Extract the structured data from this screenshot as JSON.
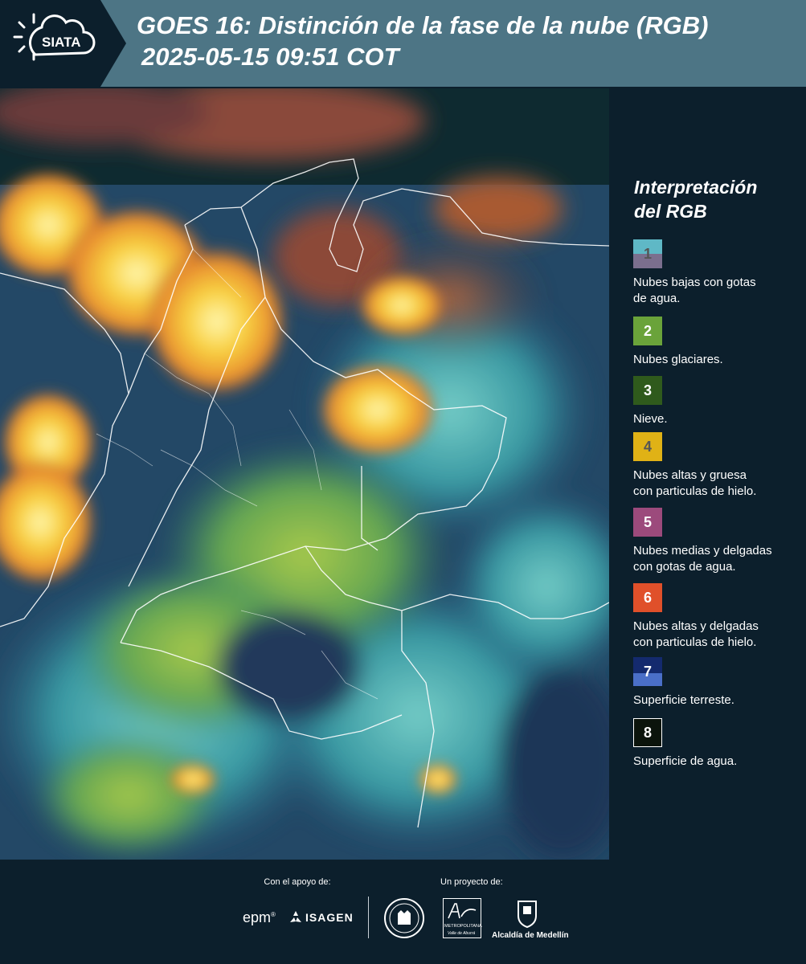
{
  "header": {
    "logo_text": "SIATA",
    "title": "GOES 16: Distinción de la fase de la nube (RGB)",
    "subtitle": "2025-05-15 09:51 COT",
    "logo_icon": "sun-cloud-icon"
  },
  "legend": {
    "title_line1": "Interpretación",
    "title_line2": "del RGB",
    "items": [
      {
        "number": "1",
        "color_top": "#5fb8c6",
        "color_bottom": "#7b6f8e",
        "number_color": "#555555",
        "text_line1": "Nubes bajas con gotas",
        "text_line2": "de agua."
      },
      {
        "number": "2",
        "color_top": "#6aa33a",
        "color_bottom": "#6aa33a",
        "number_color": "#ffffff",
        "text_line1": "Nubes glaciares.",
        "text_line2": ""
      },
      {
        "number": "3",
        "color_top": "#2f5a1c",
        "color_bottom": "#2f5a1c",
        "number_color": "#ffffff",
        "text_line1": "Nieve.",
        "text_line2": ""
      },
      {
        "number": "4",
        "color_top": "#e0b216",
        "color_bottom": "#e0b216",
        "number_color": "#555555",
        "text_line1": "Nubes altas y gruesa",
        "text_line2": "con particulas de hielo."
      },
      {
        "number": "5",
        "color_top": "#9c4a7c",
        "color_bottom": "#9c4a7c",
        "number_color": "#ffffff",
        "text_line1": "Nubes medias y delgadas",
        "text_line2": "con gotas de agua."
      },
      {
        "number": "6",
        "color_top": "#e0502a",
        "color_bottom": "#e0502a",
        "number_color": "#ffffff",
        "text_line1": "Nubes altas y delgadas",
        "text_line2": "con particulas de hielo."
      },
      {
        "number": "7",
        "color_top": "#142a6e",
        "color_bottom": "#4a6fc8",
        "number_color": "#ffffff",
        "text_line1": "Superficie terreste.",
        "text_line2": ""
      },
      {
        "number": "8",
        "color_top": "#0b140c",
        "color_bottom": "#0b140c",
        "number_color": "#ffffff",
        "text_line1": "Superficie de agua.",
        "text_line2": ""
      }
    ]
  },
  "footer": {
    "support_label": "Con el apoyo de:",
    "project_label": "Un proyecto de:",
    "logo_epm": "epm",
    "logo_isagen": "ISAGEN",
    "logo_metro_line1": "METROPOLITANA",
    "logo_metro_line2": "Valle de Aburrá",
    "logo_alcaldia": "Alcaldía de Medellín"
  }
}
